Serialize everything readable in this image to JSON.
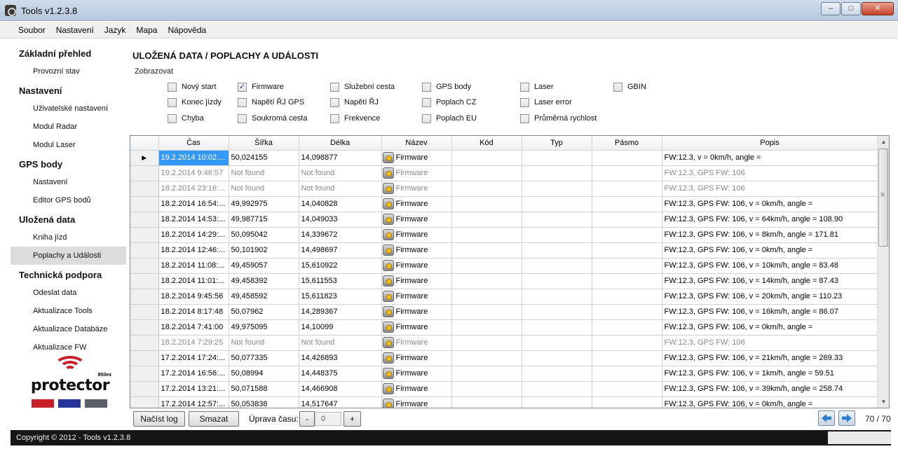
{
  "window": {
    "title": "Tools v1.2.3.8",
    "minimize": "–",
    "maximize": "□",
    "close": "✕"
  },
  "menu": [
    "Soubor",
    "Nastavení",
    "Jazyk",
    "Mapa",
    "Nápověda"
  ],
  "sidebar": {
    "sections": [
      {
        "title": "Základní přehled",
        "items": [
          "Provozní stav"
        ]
      },
      {
        "title": "Nastavení",
        "items": [
          "Uživatelské nastavení",
          "Modul Radar",
          "Modul Laser"
        ]
      },
      {
        "title": "GPS body",
        "items": [
          "Nastavení",
          "Editor GPS bodů"
        ]
      },
      {
        "title": "Uložená data",
        "items": [
          "Kniha jízd",
          "Poplachy a Události"
        ]
      },
      {
        "title": "Technická podpora",
        "items": [
          "Odeslat data",
          "Aktualizace Tools",
          "Aktualizace Databáze",
          "Aktualizace FW"
        ]
      }
    ],
    "active_item": "Poplachy a Události"
  },
  "logo": {
    "word": "protector",
    "model": "850ex"
  },
  "page_title": "ULOŽENÁ DATA / POPLACHY A UDÁLOSTI",
  "filters": {
    "legend": "Zobrazovat",
    "items": [
      {
        "label": "Nový start",
        "checked": false
      },
      {
        "label": "Konec jízdy",
        "checked": false
      },
      {
        "label": "Chyba",
        "checked": false
      },
      {
        "label": "Firmware",
        "checked": true
      },
      {
        "label": "Napětí ŘJ GPS",
        "checked": false
      },
      {
        "label": "Soukromá cesta",
        "checked": false
      },
      {
        "label": "Služební cesta",
        "checked": false
      },
      {
        "label": "Napětí ŘJ",
        "checked": false
      },
      {
        "label": "Frekvence",
        "checked": false
      },
      {
        "label": "GPS body",
        "checked": false
      },
      {
        "label": "Poplach CZ",
        "checked": false
      },
      {
        "label": "Poplach EU",
        "checked": false
      },
      {
        "label": "Laser",
        "checked": false
      },
      {
        "label": "Laser error",
        "checked": false
      },
      {
        "label": "Průměrná rychlost",
        "checked": false
      },
      {
        "label": "GBIN",
        "checked": false
      }
    ]
  },
  "table": {
    "columns": [
      "Čas",
      "Šířka",
      "Délka",
      "Název",
      "Kód",
      "Typ",
      "Pásmo",
      "Popis"
    ],
    "current_row_marker": "▶",
    "rows": [
      {
        "cas": "19.2.2014 10:02:...",
        "sirka": "50,024155",
        "delka": "14,098877",
        "nazev": "Firmware",
        "kod": "",
        "typ": "",
        "pasmo": "",
        "popis": "FW:12.3, v = 0km/h, angle =",
        "dim": false,
        "selected": true
      },
      {
        "cas": "19.2.2014 9:46:57",
        "sirka": "Not found",
        "delka": "Not found",
        "nazev": "Firmware",
        "kod": "",
        "typ": "",
        "pasmo": "",
        "popis": "FW:12.3, GPS FW: 106",
        "dim": true
      },
      {
        "cas": "18.2.2014 23:16:...",
        "sirka": "Not found",
        "delka": "Not found",
        "nazev": "Firmware",
        "kod": "",
        "typ": "",
        "pasmo": "",
        "popis": "FW:12.3, GPS FW: 106",
        "dim": true
      },
      {
        "cas": "18.2.2014 16:54:...",
        "sirka": "49,992975",
        "delka": "14,040828",
        "nazev": "Firmware",
        "kod": "",
        "typ": "",
        "pasmo": "",
        "popis": "FW:12.3, GPS FW: 106, v = 0km/h, angle =",
        "dim": false
      },
      {
        "cas": "18.2.2014 14:53:...",
        "sirka": "49,987715",
        "delka": "14,049033",
        "nazev": "Firmware",
        "kod": "",
        "typ": "",
        "pasmo": "",
        "popis": "FW:12.3, GPS FW: 106, v = 64km/h, angle = 108.90",
        "dim": false
      },
      {
        "cas": "18.2.2014 14:29:...",
        "sirka": "50,095042",
        "delka": "14,339672",
        "nazev": "Firmware",
        "kod": "",
        "typ": "",
        "pasmo": "",
        "popis": "FW:12.3, GPS FW: 106, v = 8km/h, angle = 171.81",
        "dim": false
      },
      {
        "cas": "18.2.2014 12:46:...",
        "sirka": "50,101902",
        "delka": "14,498697",
        "nazev": "Firmware",
        "kod": "",
        "typ": "",
        "pasmo": "",
        "popis": "FW:12.3, GPS FW: 106, v = 0km/h, angle =",
        "dim": false
      },
      {
        "cas": "18.2.2014 11:08:...",
        "sirka": "49,459057",
        "delka": "15,610922",
        "nazev": "Firmware",
        "kod": "",
        "typ": "",
        "pasmo": "",
        "popis": "FW:12.3, GPS FW: 106, v = 10km/h, angle = 83.48",
        "dim": false
      },
      {
        "cas": "18.2.2014 11:01:...",
        "sirka": "49,458392",
        "delka": "15,611553",
        "nazev": "Firmware",
        "kod": "",
        "typ": "",
        "pasmo": "",
        "popis": "FW:12.3, GPS FW: 106, v = 14km/h, angle = 87.43",
        "dim": false
      },
      {
        "cas": "18.2.2014 9:45:56",
        "sirka": "49,458592",
        "delka": "15,611823",
        "nazev": "Firmware",
        "kod": "",
        "typ": "",
        "pasmo": "",
        "popis": "FW:12.3, GPS FW: 106, v = 20km/h, angle = 110.23",
        "dim": false
      },
      {
        "cas": "18.2.2014 8:17:48",
        "sirka": "50,07962",
        "delka": "14,289367",
        "nazev": "Firmware",
        "kod": "",
        "typ": "",
        "pasmo": "",
        "popis": "FW:12.3, GPS FW: 106, v = 16km/h, angle = 86.07",
        "dim": false
      },
      {
        "cas": "18.2.2014 7:41:00",
        "sirka": "49,975095",
        "delka": "14,10099",
        "nazev": "Firmware",
        "kod": "",
        "typ": "",
        "pasmo": "",
        "popis": "FW:12.3, GPS FW: 106, v = 0km/h, angle =",
        "dim": false
      },
      {
        "cas": "18.2.2014 7:29:25",
        "sirka": "Not found",
        "delka": "Not found",
        "nazev": "Firmware",
        "kod": "",
        "typ": "",
        "pasmo": "",
        "popis": "FW:12.3, GPS FW: 106",
        "dim": true
      },
      {
        "cas": "17.2.2014 17:24:...",
        "sirka": "50,077335",
        "delka": "14,426893",
        "nazev": "Firmware",
        "kod": "",
        "typ": "",
        "pasmo": "",
        "popis": "FW:12.3, GPS FW: 106, v = 21km/h, angle = 269.33",
        "dim": false
      },
      {
        "cas": "17.2.2014 16:56:...",
        "sirka": "50,08994",
        "delka": "14,448375",
        "nazev": "Firmware",
        "kod": "",
        "typ": "",
        "pasmo": "",
        "popis": "FW:12.3, GPS FW: 106, v = 1km/h, angle = 59.51",
        "dim": false
      },
      {
        "cas": "17.2.2014 13:21:...",
        "sirka": "50,071588",
        "delka": "14,466908",
        "nazev": "Firmware",
        "kod": "",
        "typ": "",
        "pasmo": "",
        "popis": "FW:12.3, GPS FW: 106, v = 39km/h, angle = 258.74",
        "dim": false
      },
      {
        "cas": "17.2.2014 12:57:...",
        "sirka": "50,053838",
        "delka": "14,517647",
        "nazev": "Firmware",
        "kod": "",
        "typ": "",
        "pasmo": "",
        "popis": "FW:12.3, GPS FW: 106, v = 0km/h, angle =",
        "dim": false
      }
    ]
  },
  "bottom": {
    "load_button": "Načíst log",
    "delete_button": "Smazat",
    "time_label": "Úprava času:",
    "minus": "-",
    "time_value": "0",
    "plus": "+",
    "page_count": "70 / 70"
  },
  "status": {
    "text": "Copyright © 2012 - Tools v1.2.3.8"
  },
  "colors": {
    "selection": "#3399ff",
    "logo_red": "#c8202b",
    "logo_blue": "#27359b",
    "logo_gray": "#5a5f66",
    "statusbar": "#161616"
  }
}
